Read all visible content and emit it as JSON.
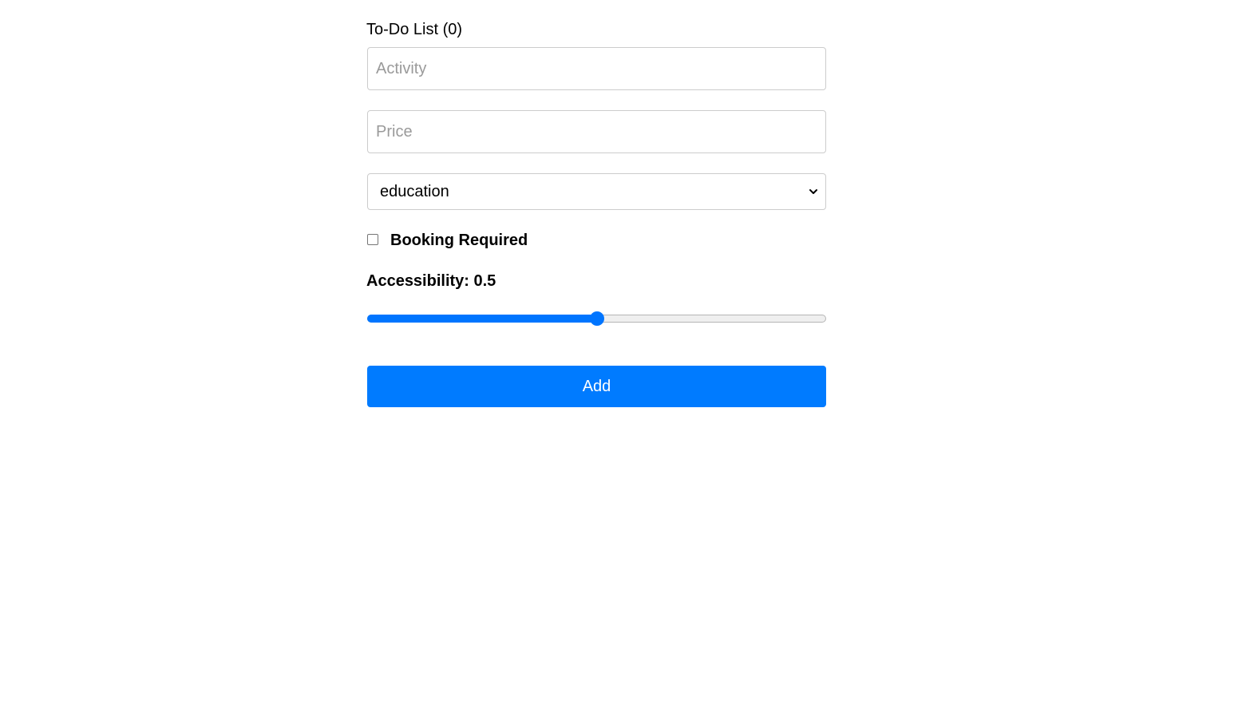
{
  "header": {
    "title": "To-Do List (0)"
  },
  "form": {
    "activity": {
      "value": "",
      "placeholder": "Activity"
    },
    "price": {
      "value": "",
      "placeholder": "Price"
    },
    "type_select": {
      "selected": "education"
    },
    "booking": {
      "label": "Booking Required",
      "checked": false
    },
    "accessibility": {
      "label": "Accessibility: 0.5",
      "value": 0.5,
      "min": 0,
      "max": 1
    },
    "add_label": "Add"
  },
  "colors": {
    "accent": "#0075ff",
    "button": "#007bff"
  },
  "icons": {
    "select_arrow": "chevron-down-icon"
  }
}
